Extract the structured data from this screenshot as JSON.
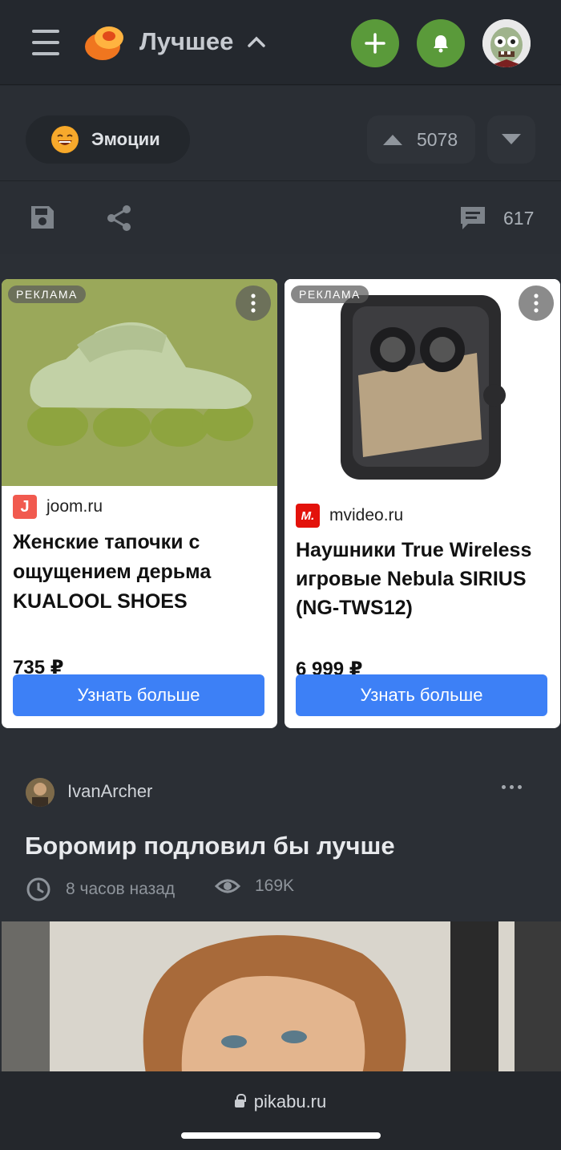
{
  "header": {
    "section_title": "Лучшее"
  },
  "post_head": {
    "tag": "Эмоции",
    "rating": "5078",
    "comments": "617"
  },
  "ads": [
    {
      "label": "РЕКЛАМА",
      "domain": "joom.ru",
      "favicon": "J",
      "title": "Женские тапочки с ощущением дерьма KUALOOL SHOES",
      "price": "735 ₽",
      "button": "Узнать больше"
    },
    {
      "label": "РЕКЛАМА",
      "domain": "mvideo.ru",
      "favicon": "M.",
      "title": "Наушники True Wireless игровые Nebula SIRIUS (NG-TWS12)",
      "price": "6 999 ₽",
      "button": "Узнать больше"
    }
  ],
  "post": {
    "author": "IvanArcher",
    "title": "Боромир подловил бы лучше",
    "time": "8 часов назад",
    "views": "169K"
  },
  "browser": {
    "url": "pikabu.ru"
  },
  "colors": {
    "accent_green": "#5a9a3a",
    "ad_button": "#3d80f6",
    "background": "#25292f"
  }
}
